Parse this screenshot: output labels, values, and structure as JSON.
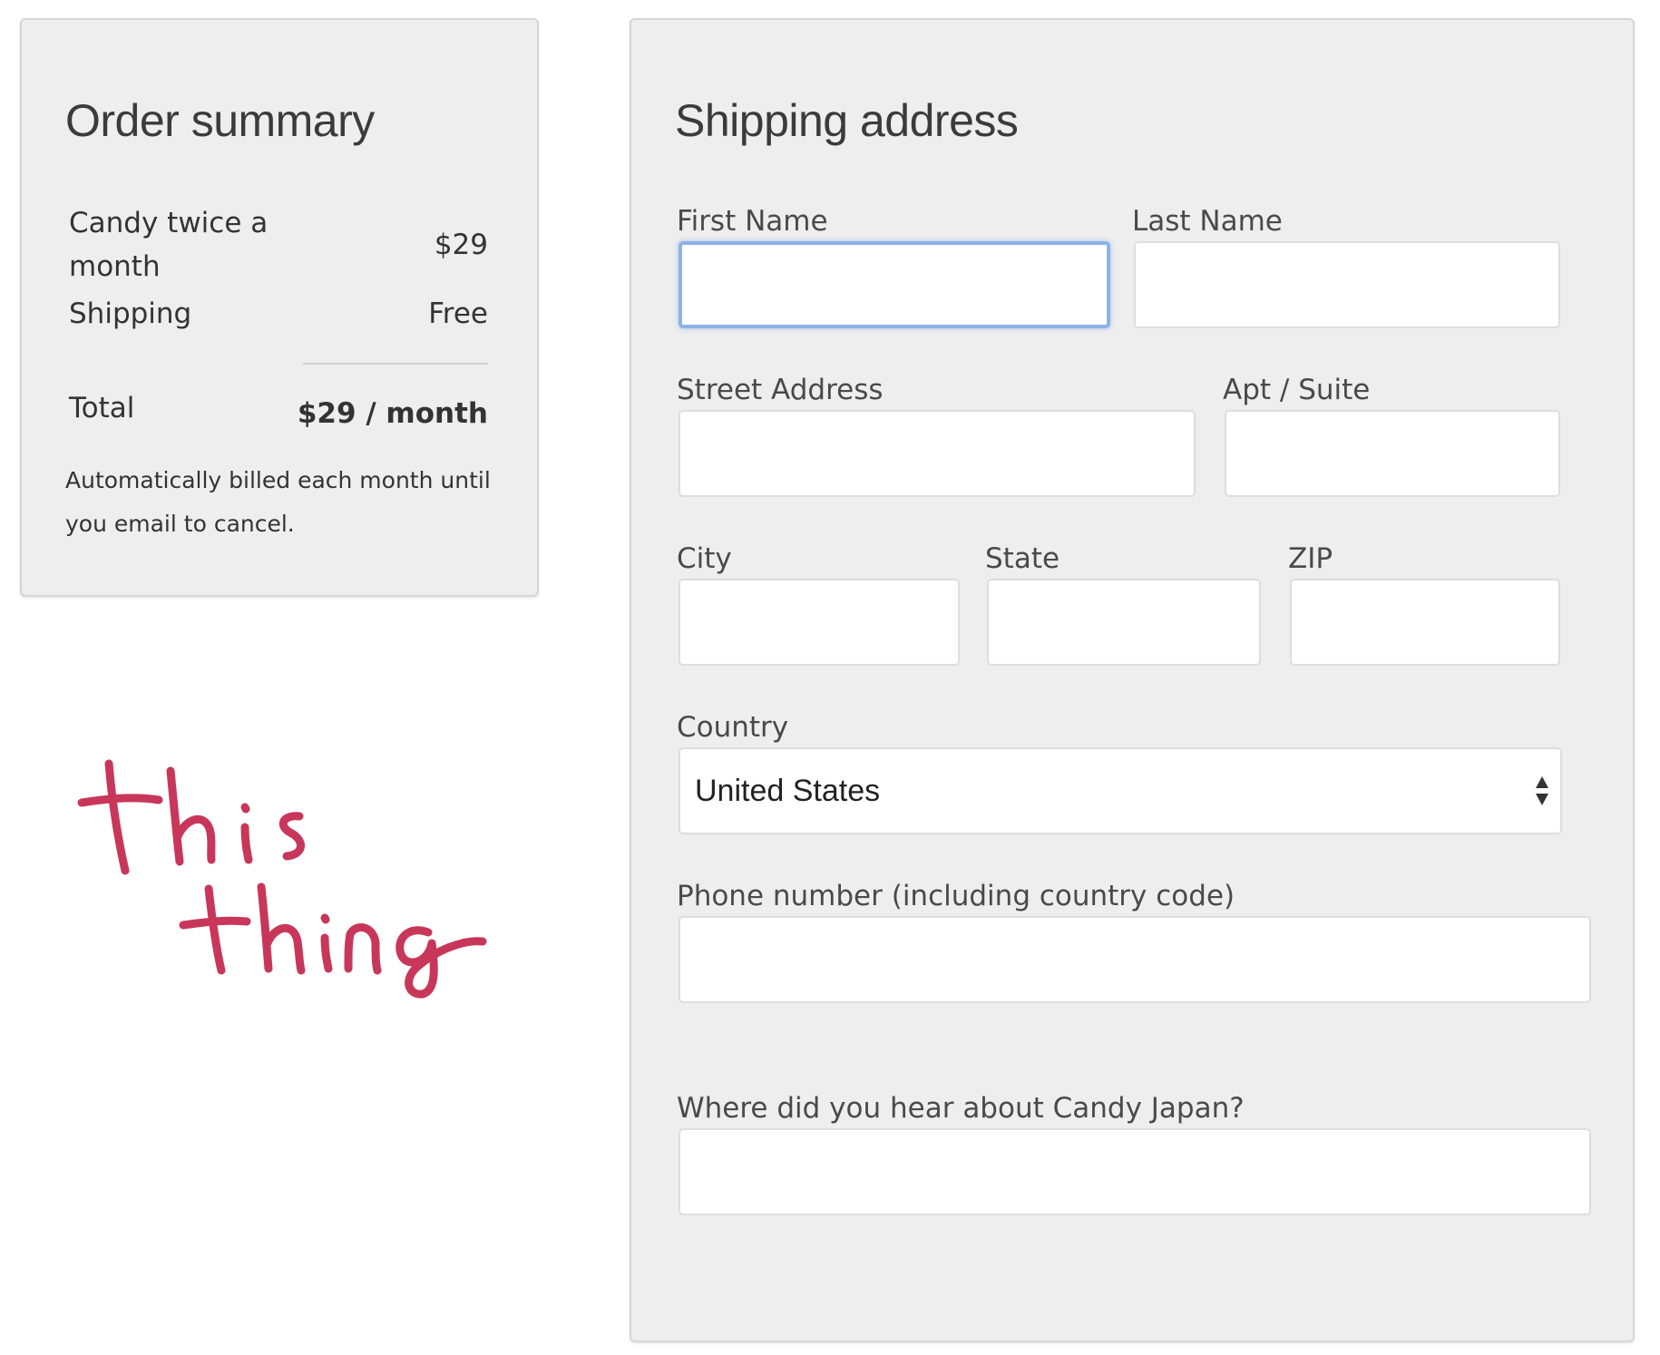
{
  "order_summary": {
    "title": "Order summary",
    "item_label": "Candy twice a month",
    "item_price": "$29",
    "shipping_label": "Shipping",
    "shipping_value": "Free",
    "total_label": "Total",
    "total_value": "$29 / month",
    "billing_note": "Automatically billed each month until you email to cancel."
  },
  "annotation": {
    "text": "this thing",
    "color": "#c8375a"
  },
  "shipping_form": {
    "title": "Shipping address",
    "first_name_label": "First Name",
    "first_name_value": "",
    "last_name_label": "Last Name",
    "last_name_value": "",
    "street_label": "Street Address",
    "street_value": "",
    "apt_label": "Apt / Suite",
    "apt_value": "",
    "city_label": "City",
    "city_value": "",
    "state_label": "State",
    "state_value": "",
    "zip_label": "ZIP",
    "zip_value": "",
    "country_label": "Country",
    "country_value": "United States",
    "phone_label": "Phone number (including country code)",
    "phone_value": "",
    "referral_label": "Where did you hear about Candy Japan?",
    "referral_value": "",
    "focus_color": "#8ab4e8"
  }
}
